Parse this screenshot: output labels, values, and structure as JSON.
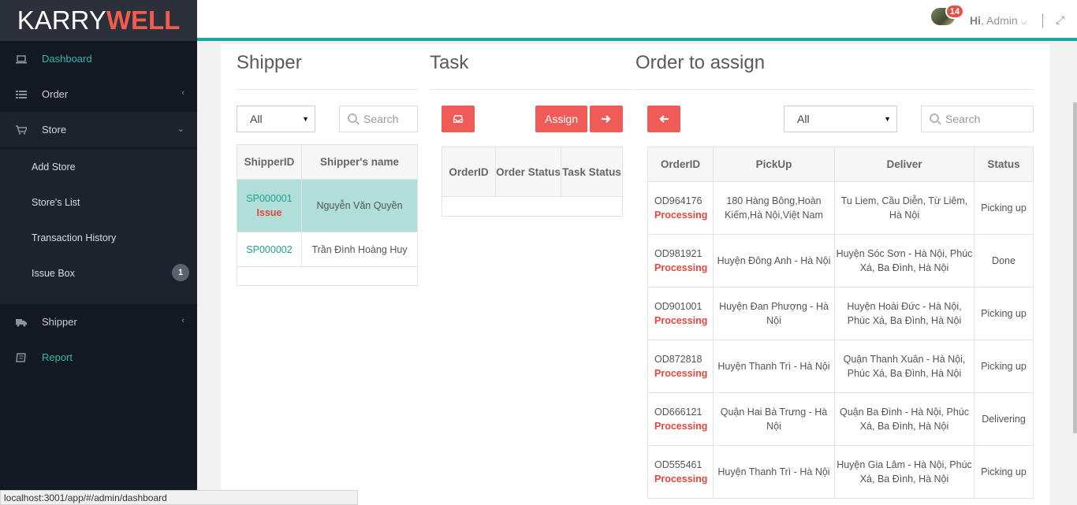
{
  "brand": {
    "part1": "KARRY",
    "part2": "WELL"
  },
  "sidebar": {
    "items": [
      {
        "label": "Dashboard",
        "icon": "laptop-icon"
      },
      {
        "label": "Order",
        "icon": "list-icon"
      },
      {
        "label": "Store",
        "icon": "cart-icon"
      },
      {
        "label": "Shipper",
        "icon": "truck-icon"
      },
      {
        "label": "Report",
        "icon": "book-icon"
      }
    ],
    "store_submenu": [
      {
        "label": "Add Store"
      },
      {
        "label": "Store's List"
      },
      {
        "label": "Transaction History"
      },
      {
        "label": "Issue Box",
        "badge": "1"
      }
    ]
  },
  "topbar": {
    "notifications": "14",
    "greeting": "Hi",
    "user": ", Admin"
  },
  "shipper": {
    "title": "Shipper",
    "filter": "All",
    "search_placeholder": "Search",
    "columns": [
      "ShipperID",
      "Shipper's name"
    ],
    "rows": [
      {
        "id": "SP000001",
        "flag": "Issue",
        "name": "Nguyễn Văn Quyền"
      },
      {
        "id": "SP000002",
        "flag": "",
        "name": "Trần Đình Hoàng Huy"
      }
    ]
  },
  "task": {
    "title": "Task",
    "assign_label": "Assign",
    "columns": [
      "OrderID",
      "Order Status",
      "Task Status"
    ]
  },
  "orders": {
    "title": "Order to assign",
    "filter": "All",
    "search_placeholder": "Search",
    "columns": [
      "OrderID",
      "PickUp",
      "Deliver",
      "Status"
    ],
    "rows": [
      {
        "id": "OD964176",
        "state": "Processing",
        "pickup": "180 Hàng Bông,Hoàn Kiếm,Hà Nội,Việt Nam",
        "deliver": "Tu Liem, Cầu Diễn, Từ Liêm, Hà Nội",
        "status": "Picking up"
      },
      {
        "id": "OD981921",
        "state": "Processing",
        "pickup": "Huyện Đông Anh - Hà Nội",
        "deliver": "Huyện Sóc Sơn - Hà Nội, Phúc Xá, Ba Đình, Hà Nội",
        "status": "Done"
      },
      {
        "id": "OD901001",
        "state": "Processing",
        "pickup": "Huyện Đan Phượng - Hà Nội",
        "deliver": "Huyện Hoài Đức - Hà Nội, Phúc Xá, Ba Đình, Hà Nội",
        "status": "Picking up"
      },
      {
        "id": "OD872818",
        "state": "Processing",
        "pickup": "Huyện Thanh Trì - Hà Nội",
        "deliver": "Quận Thanh Xuân - Hà Nội, Phúc Xá, Ba Đình, Hà Nội",
        "status": "Picking up"
      },
      {
        "id": "OD666121",
        "state": "Processing",
        "pickup": "Quận Hai Bà Trưng - Hà Nội",
        "deliver": "Quận Ba Đình - Hà Nội, Phúc Xá, Ba Đình, Hà Nội",
        "status": "Delivering"
      },
      {
        "id": "OD555461",
        "state": "Processing",
        "pickup": "Huyện Thanh Trì - Hà Nội",
        "deliver": "Huyện Gia Lâm - Hà Nội, Phúc Xá, Ba Đình, Hà Nội",
        "status": "Picking up"
      }
    ]
  },
  "statusbar": {
    "url": "localhost:3001/app/#/admin/dashboard"
  },
  "colors": {
    "accent": "#1aa89a",
    "button": "#ef5b56",
    "sidebar": "#121922",
    "selected_row": "#b0ded8"
  }
}
